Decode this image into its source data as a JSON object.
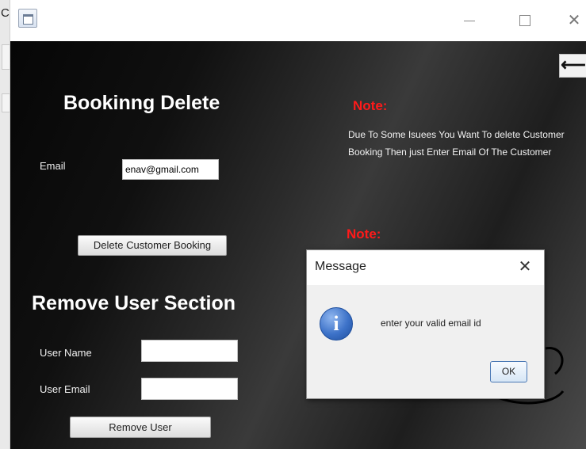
{
  "window": {
    "title": "",
    "close_glyph": "✕",
    "back_glyph": "⟵"
  },
  "booking": {
    "heading": "Bookinng Delete",
    "email_label": "Email",
    "email_value": "enav@gmail.com",
    "delete_button": "Delete Customer Booking"
  },
  "remove_user": {
    "heading": "Remove User Section",
    "username_label": "User Name",
    "username_value": "",
    "useremail_label": "User Email",
    "useremail_value": "",
    "remove_button": "Remove User"
  },
  "notes": {
    "note1_heading": "Note:",
    "note1_text": "Due To Some Isuees You Want To delete Customer Booking Then just Enter Email Of The Customer",
    "note2_heading": "Note:"
  },
  "dialog": {
    "title": "Message",
    "close_glyph": "✕",
    "icon_glyph": "i",
    "message": "enter your valid email id",
    "ok_label": "OK"
  },
  "background_app": {
    "edge_char": "C"
  },
  "colors": {
    "note_red": "#ff1a1a",
    "info_blue": "#3d72c8"
  }
}
